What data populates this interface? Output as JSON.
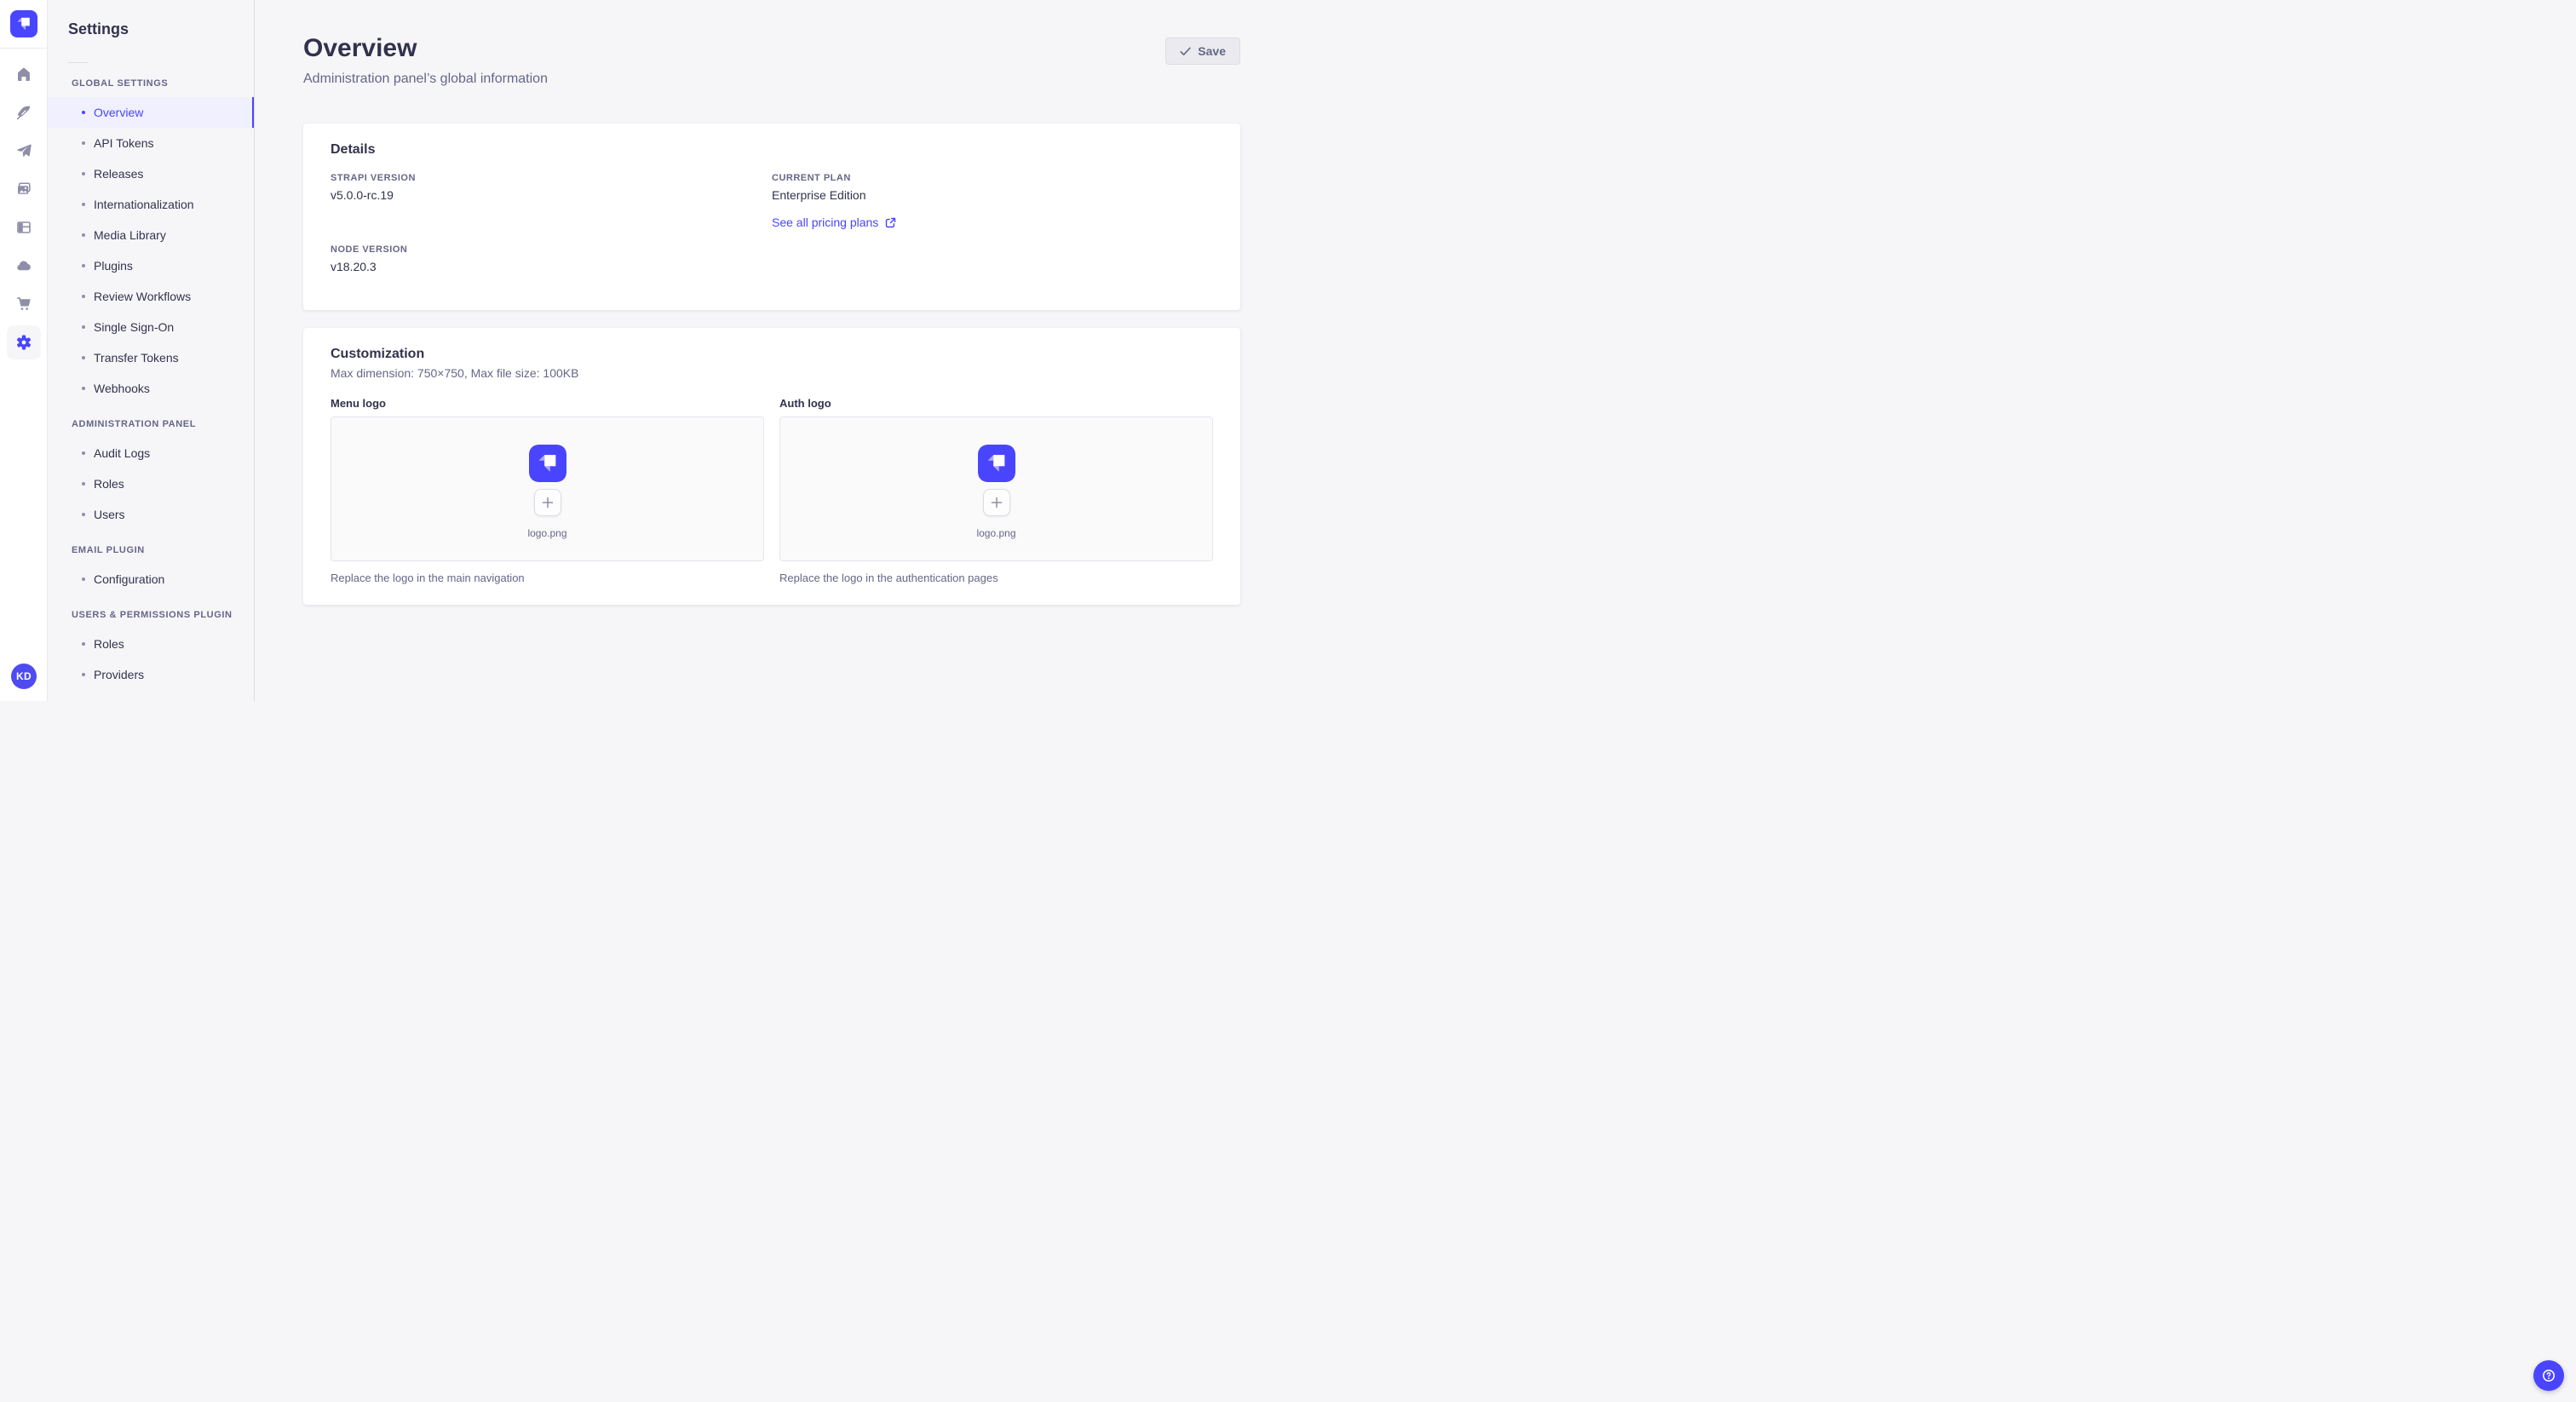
{
  "colors": {
    "accent": "#4945ff",
    "accent_bg": "#f0f0ff",
    "text_dark": "#32324d",
    "text_gray": "#666687",
    "icon_gray": "#8e8ea9"
  },
  "rail": {
    "icons": [
      "strapi-logo",
      "home",
      "feather-content",
      "paper-plane",
      "media-library",
      "layout-builder",
      "cloud",
      "cart-marketplace",
      "gear-settings"
    ],
    "active_icon": "gear-settings",
    "avatar_initials": "KD"
  },
  "sidebar": {
    "title": "Settings",
    "sections": [
      {
        "label": "Global settings",
        "items": [
          {
            "label": "Overview",
            "active": true
          },
          {
            "label": "API Tokens"
          },
          {
            "label": "Releases"
          },
          {
            "label": "Internationalization"
          },
          {
            "label": "Media Library"
          },
          {
            "label": "Plugins"
          },
          {
            "label": "Review Workflows"
          },
          {
            "label": "Single Sign-On"
          },
          {
            "label": "Transfer Tokens"
          },
          {
            "label": "Webhooks"
          }
        ]
      },
      {
        "label": "Administration panel",
        "items": [
          {
            "label": "Audit Logs"
          },
          {
            "label": "Roles"
          },
          {
            "label": "Users"
          }
        ]
      },
      {
        "label": "Email plugin",
        "items": [
          {
            "label": "Configuration"
          }
        ]
      },
      {
        "label": "Users & Permissions plugin",
        "items": [
          {
            "label": "Roles"
          },
          {
            "label": "Providers"
          }
        ]
      }
    ]
  },
  "header": {
    "title": "Overview",
    "subtitle": "Administration panel’s global information",
    "save_label": "Save"
  },
  "details": {
    "heading": "Details",
    "strapi_version": {
      "label": "Strapi version",
      "value": "v5.0.0-rc.19"
    },
    "node_version": {
      "label": "Node version",
      "value": "v18.20.3"
    },
    "current_plan": {
      "label": "Current plan",
      "value": "Enterprise Edition"
    },
    "pricing_link_label": "See all pricing plans"
  },
  "customization": {
    "heading": "Customization",
    "subheading": "Max dimension: 750×750, Max file size: 100KB",
    "menu_logo": {
      "label": "Menu logo",
      "filename": "logo.png",
      "caption": "Replace the logo in the main navigation"
    },
    "auth_logo": {
      "label": "Auth logo",
      "filename": "logo.png",
      "caption": "Replace the logo in the authentication pages"
    }
  },
  "help": {
    "label": "help"
  }
}
